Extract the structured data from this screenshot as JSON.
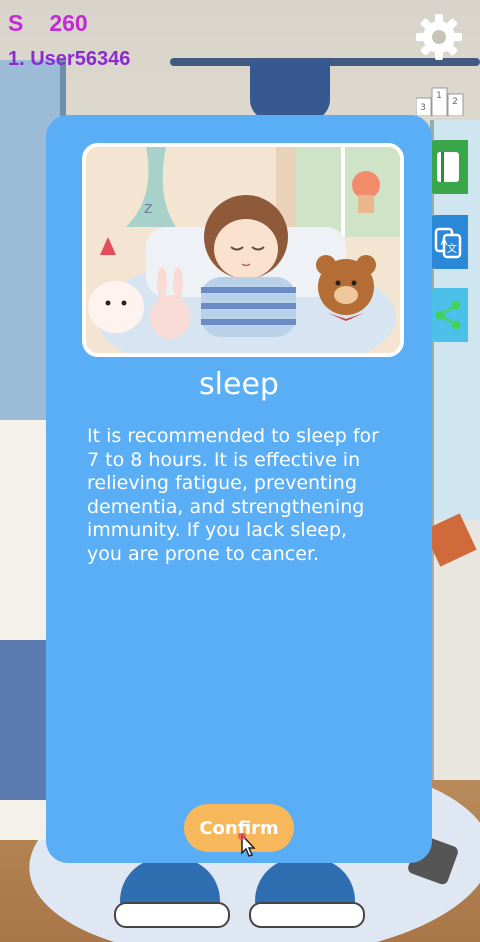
{
  "hud": {
    "score_label": "S",
    "score_value": "260",
    "user_rank": "1. User56346"
  },
  "icons": {
    "settings": "gear-icon",
    "leaderboard": "podium-icon",
    "book": "book-icon",
    "translate": "translate-icon",
    "share": "share-icon"
  },
  "modal": {
    "title": "sleep",
    "description": "It is recommended to sleep for 7 to 8 hours. It is effective in relieving fatigue, preventing dementia, and strengthening immunity. If you lack sleep, you are prone to cancer.",
    "confirm_label": "Confirm"
  },
  "podium_numbers": [
    "3",
    "1",
    "2"
  ],
  "colors": {
    "modal_bg": "#5aaef5",
    "confirm_bg": "#f6b85a",
    "score_text": "#c42ad6"
  }
}
